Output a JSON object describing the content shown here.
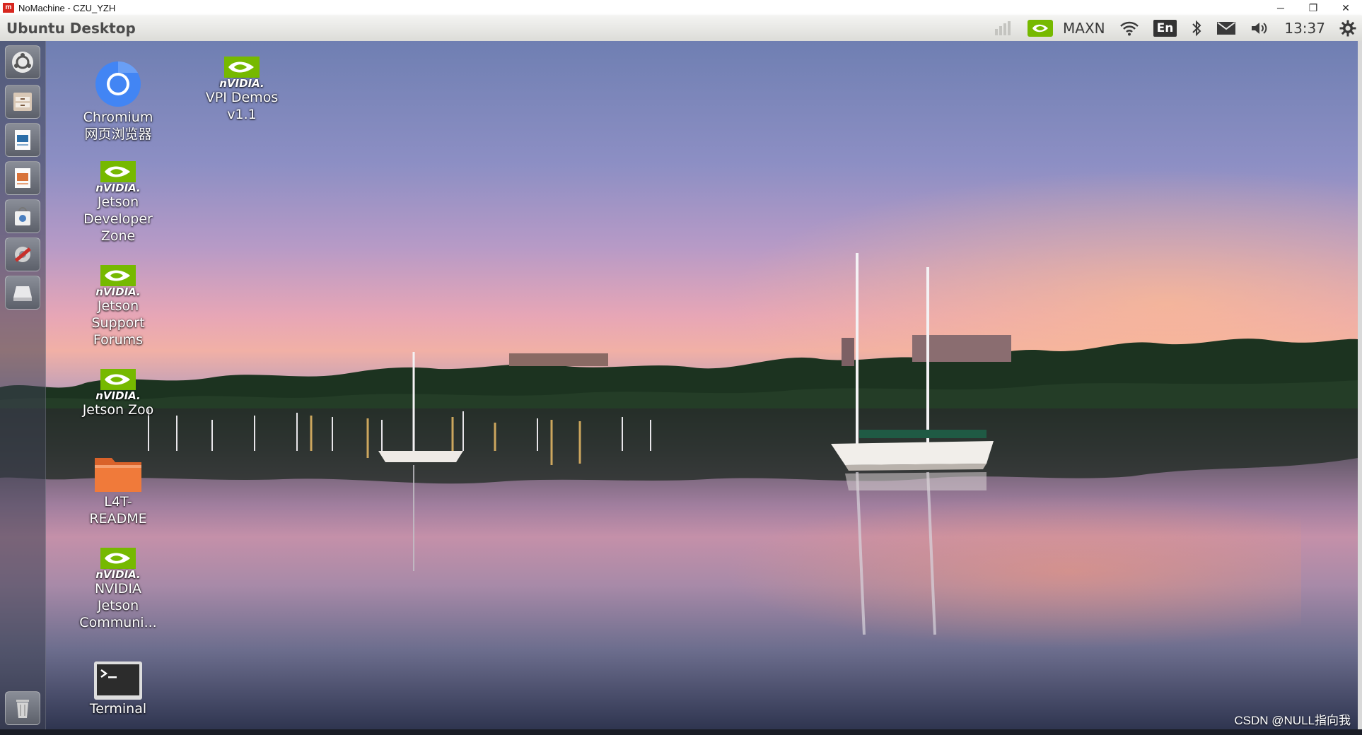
{
  "window": {
    "title": "NoMachine - CZU_YZH",
    "logo_text": "m",
    "controls": {
      "minimize": "─",
      "restore": "❐",
      "close": "✕"
    }
  },
  "panel": {
    "title": "Ubuntu Desktop",
    "power_mode": "MAXN",
    "keyboard_layout": "En",
    "clock": "13:37",
    "icons": [
      "network-activity-icon",
      "nvidia-icon",
      "wifi-icon",
      "bluetooth-icon",
      "mail-icon",
      "volume-icon",
      "settings-gear-icon"
    ]
  },
  "launcher": {
    "items": [
      "ubuntu-search",
      "files",
      "libreoffice-writer",
      "libreoffice-impress",
      "software-center",
      "system-settings",
      "disk-drive",
      "trash"
    ]
  },
  "desktop": {
    "icons": [
      {
        "id": "chromium",
        "line1": "Chromium",
        "line2": "网页浏览器",
        "line3": ""
      },
      {
        "id": "vpi-demos",
        "line1": "VPI Demos",
        "line2": "v1.1",
        "line3": ""
      },
      {
        "id": "jetson-dev-zone",
        "line1": "Jetson",
        "line2": "Developer",
        "line3": "Zone"
      },
      {
        "id": "jetson-forums",
        "line1": "Jetson",
        "line2": "Support",
        "line3": "Forums"
      },
      {
        "id": "jetson-zoo",
        "line1": "Jetson Zoo",
        "line2": "",
        "line3": ""
      },
      {
        "id": "l4t-readme",
        "line1": "L4T-",
        "line2": "README",
        "line3": ""
      },
      {
        "id": "nvidia-community",
        "line1": "NVIDIA",
        "line2": "Jetson",
        "line3": "Communi..."
      },
      {
        "id": "terminal",
        "line1": "Terminal",
        "line2": "",
        "line3": ""
      }
    ],
    "nvidia_wordmark": "nVIDIA.",
    "watermark": "CSDN @NULL指向我"
  },
  "colors": {
    "nvidia_green": "#76b900",
    "chromium_blue": "#4285f4",
    "folder_orange": "#f07a3a",
    "panel_bg": "#e6e6e2"
  }
}
